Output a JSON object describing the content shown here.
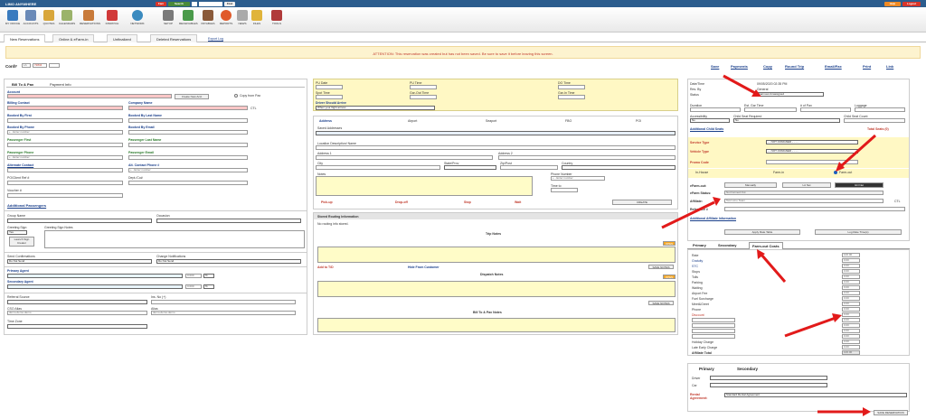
{
  "app": {
    "title": "LIMO ANYWHERE",
    "top_buttons": [
      "Fam",
      "Search",
      "",
      "",
      "Find"
    ],
    "help": "Help",
    "logout": "Logout"
  },
  "toolbar": {
    "items": [
      "MY OFFICE",
      "ACCOUNTS",
      "QUOTES",
      "CALENDARS",
      "RESERVATIONS",
      "RESERVE",
      "DISPATCH",
      "NETWORK",
      "SETUP",
      "RECEIVABLES",
      "PAYABLES",
      "PAYROLL",
      "REPORTS",
      "NEWS",
      "FILES",
      "TOOLS"
    ]
  },
  "tabs": {
    "items": [
      "New Reservations",
      "Online & eFarm-in",
      "Unfinalized",
      "Deleted Reservations"
    ],
    "export": "Export Log"
  },
  "attention": "ATTENTION: This reservation was created but has not been saved. Be sure to save it before leaving this screen.",
  "conf": {
    "label": "Conf#",
    "prefix": "LA",
    "number": "72834"
  },
  "left": {
    "tabs": [
      "Bill To & Pax",
      "Payment Info"
    ],
    "account": "Account",
    "create_acct": "Create New Acct",
    "copy_from_pax": "Copy from Pax",
    "billing_contact": "Billing Contact",
    "company_name": "Company Name",
    "ctl": "CTL",
    "booked_first": "Booked By First",
    "booked_last": "Booked By Last Name",
    "booked_phone": "Booked By Phone",
    "booked_email": "Booked By Email",
    "enter_number": "+ - Enter number",
    "pax_first": "Passenger First",
    "pax_last": "Passenger Last Name",
    "pax_phone": "Passenger Phone",
    "pax_email": "Passenger Email",
    "alt_contact": "Alternate Contact",
    "alt_phone": "Alt. Contact Phone #",
    "ref": "PO/Client Ref #",
    "dept": "Dept./Co#",
    "voucher": "Voucher #",
    "additional_pax": "Additional Passengers",
    "group_name": "Group Name",
    "occasion": "Occasion",
    "greeting": "Greeting Sign",
    "greeting_val": "Yes",
    "greeting_notes": "Greeting Sign Notes",
    "launch": "Launch Sign Creator",
    "send_conf": "Send Confirmations",
    "change_notif": "Change Notifications",
    "do_not_send": "Do Not Send",
    "primary_agent": "Primary Agent",
    "secondary_agent": "Secondary Agent",
    "pct": "0.000",
    "pct_sign": "%",
    "referral": "Referral Source",
    "ins": "Ins. No (+)",
    "cso": "CSO Alias",
    "alias": "Alias",
    "alias_val": "demo-demo-demo",
    "alias_val2": "demo-demo-demo",
    "time_zone": "Time Zone"
  },
  "mid": {
    "pu_date": "PU Date",
    "pu_time": "PU Time",
    "do_time": "DO Time",
    "spot_time": "Spot Time",
    "gar_out": "Gar-Out Time",
    "gar_in": "Gar-In Time",
    "driver_arrive": "Driver Should Arrive",
    "driver_arrive_val": "When your flight arrives",
    "loc_tabs": [
      "Address",
      "Airport",
      "Seaport",
      "FBO",
      "POI"
    ],
    "saved_addresses": "Saved Addresses",
    "location_name": "Location Description/ Name",
    "address1": "Address 1",
    "address2": "Address 2",
    "city": "City",
    "state": "State/Prov",
    "zip": "Zip/Post",
    "country": "Country",
    "notes": "Notes",
    "phone": "Phone Number",
    "time_to": "Time to",
    "stop_types": [
      "Pick-up",
      "Drop-off",
      "Stop",
      "Wait"
    ],
    "create": "CREATE",
    "routing_header": "Stored Routing Information",
    "no_routing": "No routing info stored.",
    "trip_notes": "Trip Notes",
    "add_to": "Add to T/D",
    "hide": "Hide From Customer",
    "save_notes": "SAVE NOTES",
    "dispatch_notes": "Dispatch Notes",
    "billpax_notes": "Bill To & Pax Notes",
    "open": "OPEN"
  },
  "right": {
    "actions": [
      "Save",
      "Payments",
      "Copy",
      "Round Trip",
      "Email/Fax",
      "Print",
      "Link"
    ],
    "date_time": "Date/Time",
    "date_val": "09/05/2020 02:35 PM",
    "res_by": "Res. By",
    "res_by_val": "General",
    "status": "Status",
    "status_val": "Farmout-Unassigned",
    "duration": "Duration",
    "est_time": "Est. Gar Time",
    "pax_count": "# of Pax",
    "luggage": "Luggage",
    "accessibility": "Accessibility",
    "child_seat": "Child Seat Required",
    "no": "No",
    "child_count": "Child Seat Count",
    "addl_child": "Additional Child Seats",
    "total_seats": "Total Seats (0)",
    "service_type": "Service Type",
    "vehicle_type": "Vehicle Type",
    "promo_code": "Promo Code",
    "not_assigned": "- - NOT ASSIGNED - - - -",
    "radios": [
      "In-House",
      "Farm-in",
      "Farm-out"
    ],
    "efarm_out": "eFarm-out:",
    "manually": "Manually",
    "la_net": "LA Net",
    "gn_net": "GN Net",
    "efarm_status": "eFarm Status:",
    "efarm_status_val": "Not Farmed Out",
    "affiliate": "Affiliate:",
    "affiliate_val": "Test Limo Team",
    "reference": "Reference #",
    "addl_affiliate": "Additional Affiliate Information",
    "apply_rate": "Apply Rate Table",
    "log_rate": "Log Rate Time(s)",
    "cost_tabs": [
      "Primary",
      "Secondary",
      "Farm-out Costs"
    ],
    "costs": [
      "Rate",
      "Gratuity",
      "STC",
      "Stops",
      "Tolls",
      "Parking",
      "Waiting",
      "Airport Fee",
      "Fuel Surcharge",
      "Meet&Greet",
      "Phone",
      "Discount",
      "",
      "",
      "",
      "",
      "Holiday Charge",
      "Late Early Charge",
      "Affiliate Total"
    ],
    "cost_vals": [
      "100.00",
      "0.00",
      "0.00",
      "0.00",
      "0.00",
      "0.00",
      "0.00",
      "0.00",
      "0.00",
      "0.00",
      "0.00",
      "0.00",
      "0.00",
      "0.00",
      "0.00",
      "0.00",
      "0.00",
      "0.00",
      "100.00"
    ],
    "pay_tabs": [
      "Primary",
      "Secondary"
    ],
    "driver": "Driver",
    "car": "Car",
    "rental": "Rental Agreement:",
    "rental_val": "Standard Rental Agreement",
    "save_res": "SAVE RESERVATION"
  },
  "colors": {
    "title": "#2c5d8e",
    "alert": "#c0392b",
    "arrow": "#e21a1a",
    "yellow": "#fff8c4"
  }
}
